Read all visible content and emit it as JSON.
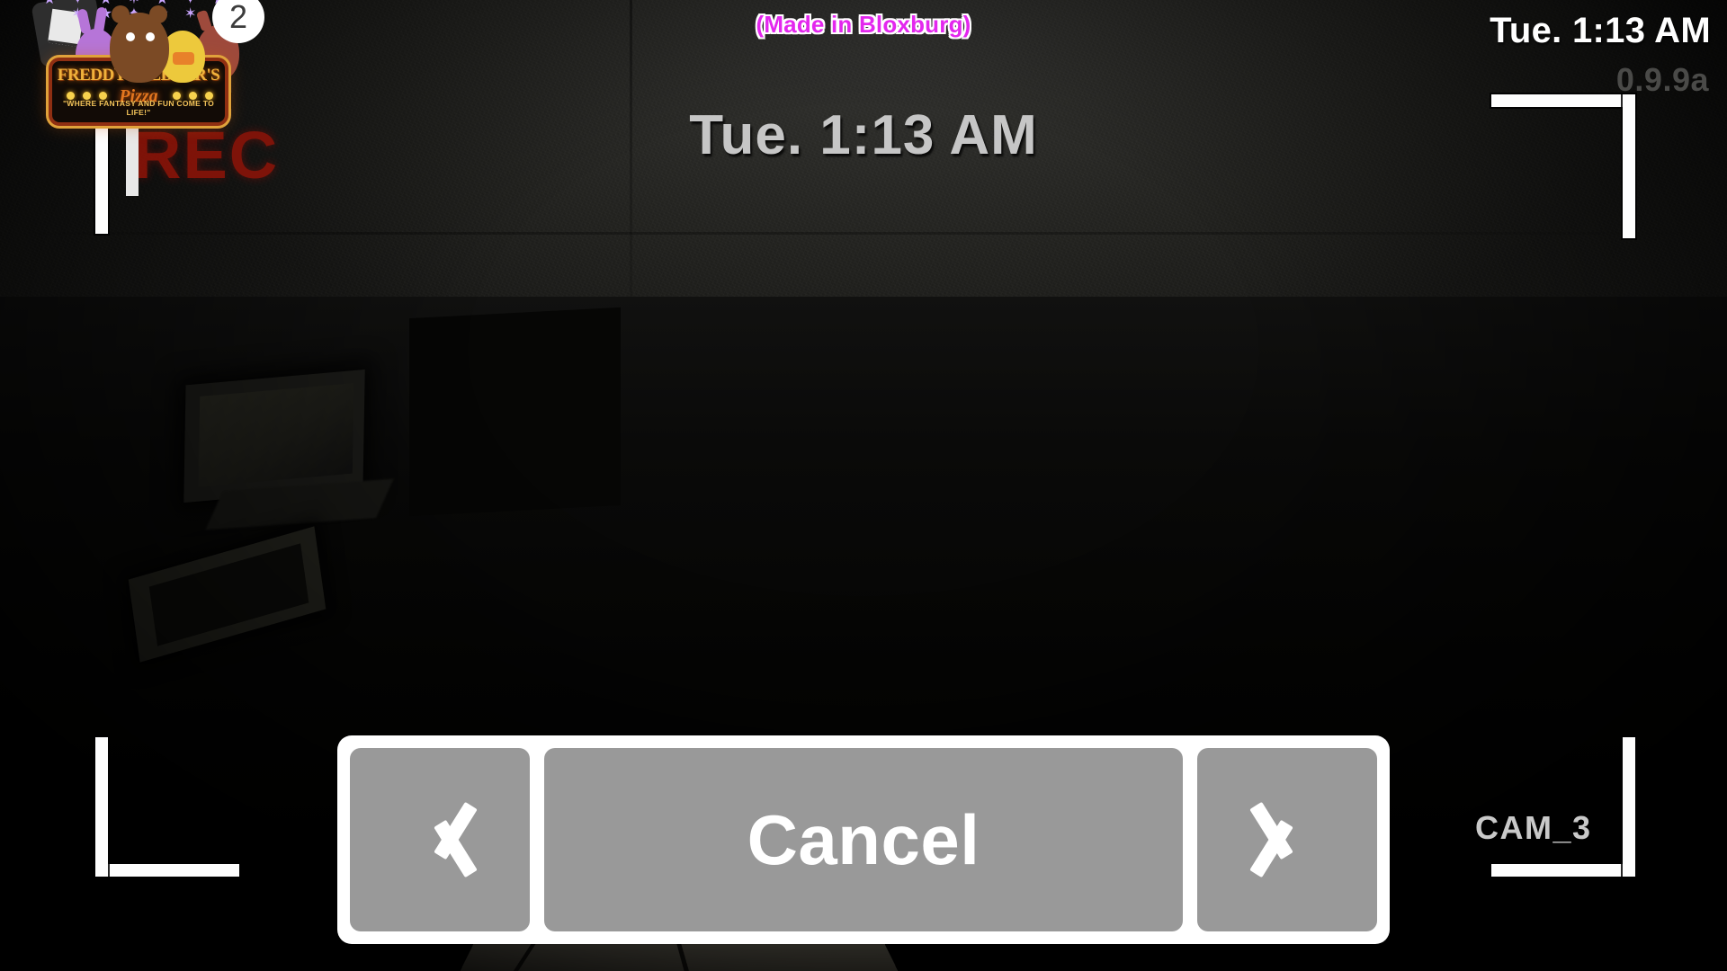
{
  "hud": {
    "made_in_label": "(Made in Bloxburg)",
    "center_clock": "Tue. 1:13 AM",
    "corner_clock": "Tue. 1:13 AM",
    "version": "0.9.9a",
    "camera_label": "CAM_3",
    "rec_indicator": "REC"
  },
  "logo": {
    "title": "FREDDY FAZBEAR'S",
    "subtitle": "Pizza",
    "tagline": "\"WHERE FANTASY AND FUN COME TO LIFE!\"",
    "notification_count": "2",
    "stars": "★ ✦ ★ ✶ ★ ✦ ★ ✶ ★ ✦ ★ ✶"
  },
  "controls": {
    "prev_label": "Previous camera",
    "cancel_label": "Cancel",
    "next_label": "Next camera"
  },
  "colors": {
    "made_in_text": "#e327ee",
    "made_in_outline": "#ffffff",
    "button_fill": "#999999",
    "panel_frame": "#ffffff",
    "bracket": "#fdfdfd",
    "center_clock": "#c6c6c6",
    "cam_label": "#c9c9c9",
    "version_text": "#4a4a48",
    "rec_text": "#8e1408"
  }
}
